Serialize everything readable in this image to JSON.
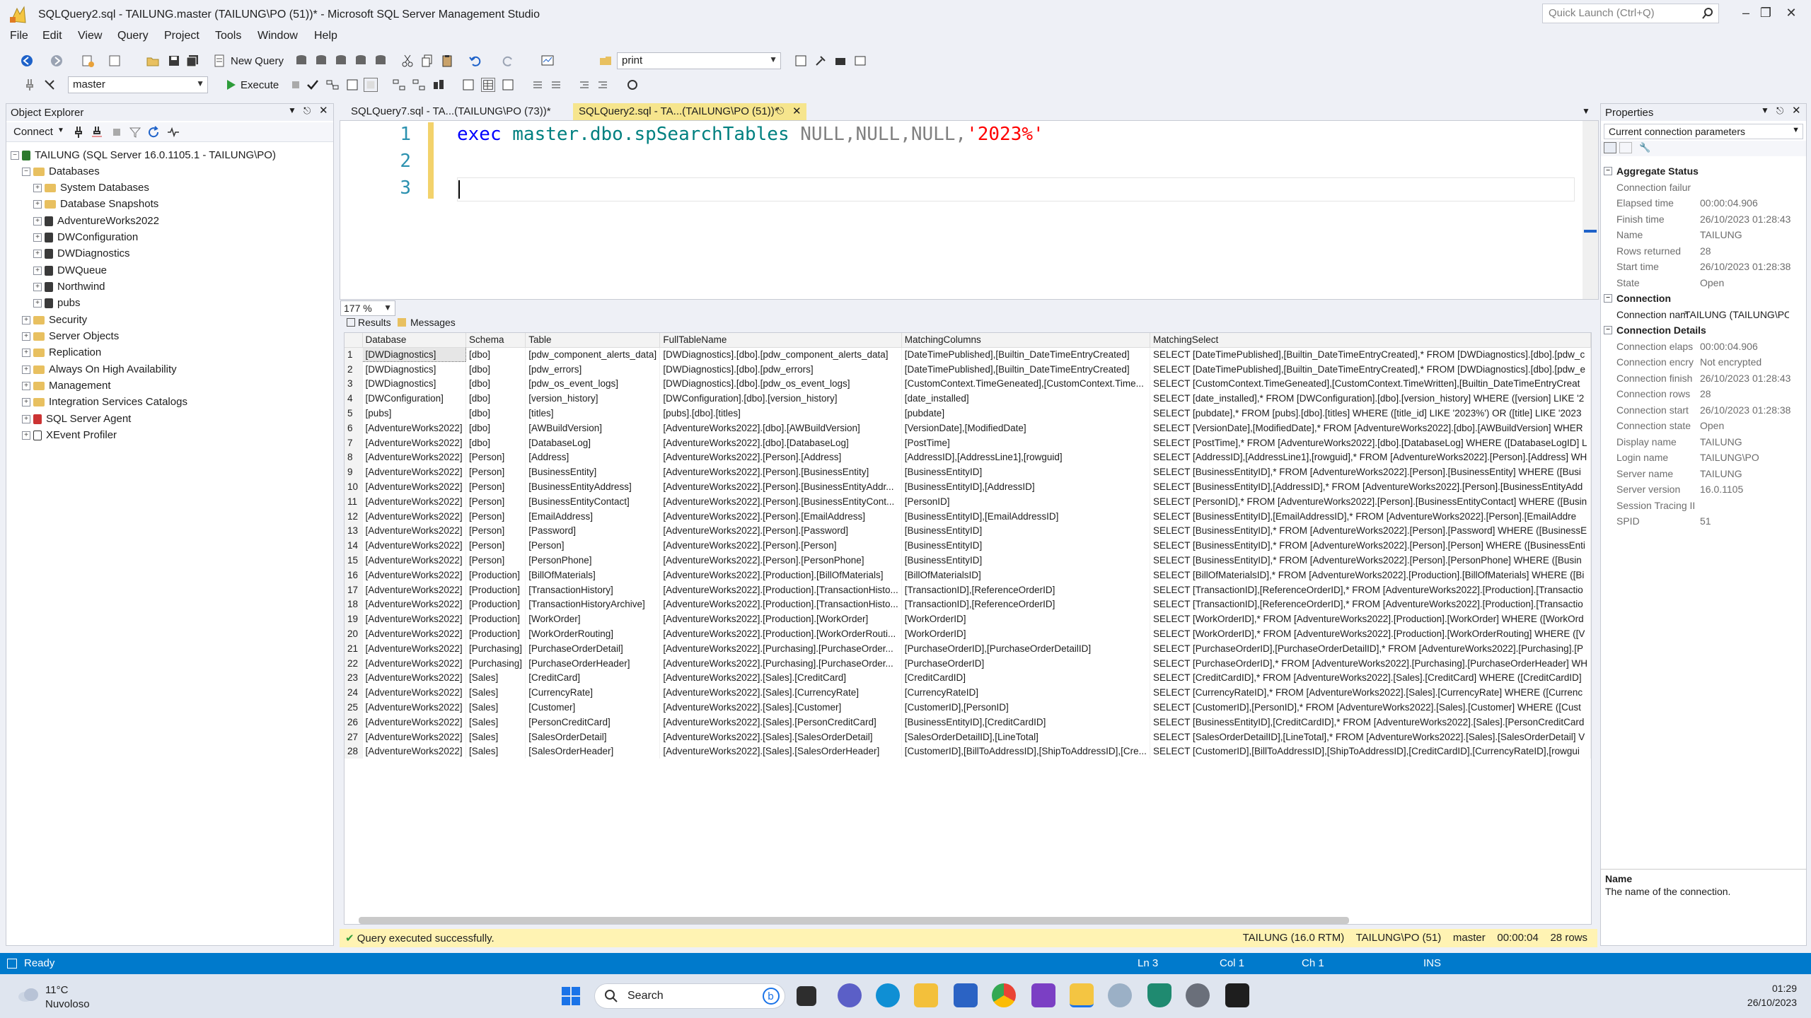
{
  "window": {
    "title": "SQLQuery2.sql - TAILUNG.master (TAILUNG\\PO (51))* - Microsoft SQL Server Management Studio",
    "quick_launch_placeholder": "Quick Launch (Ctrl+Q)"
  },
  "menu": [
    "File",
    "Edit",
    "View",
    "Query",
    "Project",
    "Tools",
    "Window",
    "Help"
  ],
  "toolbar": {
    "new_query": "New Query",
    "solution_combo": "print",
    "database_combo": "master",
    "execute": "Execute"
  },
  "object_explorer": {
    "title": "Object Explorer",
    "connect": "Connect",
    "server": "TAILUNG (SQL Server 16.0.1105.1 - TAILUNG\\PO)",
    "databases_label": "Databases",
    "db_folders": [
      "System Databases",
      "Database Snapshots"
    ],
    "databases": [
      "AdventureWorks2022",
      "DWConfiguration",
      "DWDiagnostics",
      "DWQueue",
      "Northwind",
      "pubs"
    ],
    "server_nodes": [
      "Security",
      "Server Objects",
      "Replication",
      "Always On High Availability",
      "Management",
      "Integration Services Catalogs",
      "SQL Server Agent",
      "XEvent Profiler"
    ]
  },
  "tabs": [
    {
      "label": "SQLQuery7.sql - TA...(TAILUNG\\PO (73))*"
    },
    {
      "label": "SQLQuery2.sql - TA...(TAILUNG\\PO (51))*"
    }
  ],
  "editor": {
    "line_numbers": [
      "1",
      "2",
      "3"
    ],
    "code": {
      "kw": "exec",
      "obj": "master.dbo.spSearchTables",
      "nulls": "NULL,NULL,NULL,",
      "str": "'2023%'"
    },
    "zoom": "177 %"
  },
  "results": {
    "tabs": [
      "Results",
      "Messages"
    ],
    "columns": [
      "Database",
      "Schema",
      "Table",
      "FullTableName",
      "MatchingColumns",
      "MatchingSelect"
    ],
    "rows": [
      [
        "1",
        "[DWDiagnostics]",
        "[dbo]",
        "[pdw_component_alerts_data]",
        "[DWDiagnostics].[dbo].[pdw_component_alerts_data]",
        "[DateTimePublished],[Builtin_DateTimeEntryCreated]",
        "SELECT [DateTimePublished],[Builtin_DateTimeEntryCreated],* FROM [DWDiagnostics].[dbo].[pdw_c"
      ],
      [
        "2",
        "[DWDiagnostics]",
        "[dbo]",
        "[pdw_errors]",
        "[DWDiagnostics].[dbo].[pdw_errors]",
        "[DateTimePublished],[Builtin_DateTimeEntryCreated]",
        "SELECT [DateTimePublished],[Builtin_DateTimeEntryCreated],* FROM [DWDiagnostics].[dbo].[pdw_e"
      ],
      [
        "3",
        "[DWDiagnostics]",
        "[dbo]",
        "[pdw_os_event_logs]",
        "[DWDiagnostics].[dbo].[pdw_os_event_logs]",
        "[CustomContext.TimeGeneated],[CustomContext.Time...",
        "SELECT [CustomContext.TimeGeneated],[CustomContext.TimeWritten],[Builtin_DateTimeEntryCreat"
      ],
      [
        "4",
        "[DWConfiguration]",
        "[dbo]",
        "[version_history]",
        "[DWConfiguration].[dbo].[version_history]",
        "[date_installed]",
        "SELECT [date_installed],* FROM [DWConfiguration].[dbo].[version_history] WHERE ([version] LIKE '2"
      ],
      [
        "5",
        "[pubs]",
        "[dbo]",
        "[titles]",
        "[pubs].[dbo].[titles]",
        "[pubdate]",
        "SELECT [pubdate],* FROM [pubs].[dbo].[titles] WHERE ([title_id] LIKE '2023%') OR ([title] LIKE '2023"
      ],
      [
        "6",
        "[AdventureWorks2022]",
        "[dbo]",
        "[AWBuildVersion]",
        "[AdventureWorks2022].[dbo].[AWBuildVersion]",
        "[VersionDate],[ModifiedDate]",
        "SELECT [VersionDate],[ModifiedDate],* FROM [AdventureWorks2022].[dbo].[AWBuildVersion] WHER"
      ],
      [
        "7",
        "[AdventureWorks2022]",
        "[dbo]",
        "[DatabaseLog]",
        "[AdventureWorks2022].[dbo].[DatabaseLog]",
        "[PostTime]",
        "SELECT [PostTime],* FROM [AdventureWorks2022].[dbo].[DatabaseLog] WHERE ([DatabaseLogID] L"
      ],
      [
        "8",
        "[AdventureWorks2022]",
        "[Person]",
        "[Address]",
        "[AdventureWorks2022].[Person].[Address]",
        "[AddressID],[AddressLine1],[rowguid]",
        "SELECT [AddressID],[AddressLine1],[rowguid],* FROM [AdventureWorks2022].[Person].[Address] WH"
      ],
      [
        "9",
        "[AdventureWorks2022]",
        "[Person]",
        "[BusinessEntity]",
        "[AdventureWorks2022].[Person].[BusinessEntity]",
        "[BusinessEntityID]",
        "SELECT [BusinessEntityID],* FROM [AdventureWorks2022].[Person].[BusinessEntity] WHERE ([Busi"
      ],
      [
        "10",
        "[AdventureWorks2022]",
        "[Person]",
        "[BusinessEntityAddress]",
        "[AdventureWorks2022].[Person].[BusinessEntityAddr...",
        "[BusinessEntityID],[AddressID]",
        "SELECT [BusinessEntityID],[AddressID],* FROM [AdventureWorks2022].[Person].[BusinessEntityAdd"
      ],
      [
        "11",
        "[AdventureWorks2022]",
        "[Person]",
        "[BusinessEntityContact]",
        "[AdventureWorks2022].[Person].[BusinessEntityCont...",
        "[PersonID]",
        "SELECT [PersonID],* FROM [AdventureWorks2022].[Person].[BusinessEntityContact] WHERE ([Busin"
      ],
      [
        "12",
        "[AdventureWorks2022]",
        "[Person]",
        "[EmailAddress]",
        "[AdventureWorks2022].[Person].[EmailAddress]",
        "[BusinessEntityID],[EmailAddressID]",
        "SELECT [BusinessEntityID],[EmailAddressID],* FROM [AdventureWorks2022].[Person].[EmailAddre"
      ],
      [
        "13",
        "[AdventureWorks2022]",
        "[Person]",
        "[Password]",
        "[AdventureWorks2022].[Person].[Password]",
        "[BusinessEntityID]",
        "SELECT [BusinessEntityID],* FROM [AdventureWorks2022].[Person].[Password] WHERE ([BusinessE"
      ],
      [
        "14",
        "[AdventureWorks2022]",
        "[Person]",
        "[Person]",
        "[AdventureWorks2022].[Person].[Person]",
        "[BusinessEntityID]",
        "SELECT [BusinessEntityID],* FROM [AdventureWorks2022].[Person].[Person] WHERE ([BusinessEnti"
      ],
      [
        "15",
        "[AdventureWorks2022]",
        "[Person]",
        "[PersonPhone]",
        "[AdventureWorks2022].[Person].[PersonPhone]",
        "[BusinessEntityID]",
        "SELECT [BusinessEntityID],* FROM [AdventureWorks2022].[Person].[PersonPhone] WHERE ([Busin"
      ],
      [
        "16",
        "[AdventureWorks2022]",
        "[Production]",
        "[BillOfMaterials]",
        "[AdventureWorks2022].[Production].[BillOfMaterials]",
        "[BillOfMaterialsID]",
        "SELECT [BillOfMaterialsID],* FROM [AdventureWorks2022].[Production].[BillOfMaterials] WHERE ([Bi"
      ],
      [
        "17",
        "[AdventureWorks2022]",
        "[Production]",
        "[TransactionHistory]",
        "[AdventureWorks2022].[Production].[TransactionHisto...",
        "[TransactionID],[ReferenceOrderID]",
        "SELECT [TransactionID],[ReferenceOrderID],* FROM [AdventureWorks2022].[Production].[Transactio"
      ],
      [
        "18",
        "[AdventureWorks2022]",
        "[Production]",
        "[TransactionHistoryArchive]",
        "[AdventureWorks2022].[Production].[TransactionHisto...",
        "[TransactionID],[ReferenceOrderID]",
        "SELECT [TransactionID],[ReferenceOrderID],* FROM [AdventureWorks2022].[Production].[Transactio"
      ],
      [
        "19",
        "[AdventureWorks2022]",
        "[Production]",
        "[WorkOrder]",
        "[AdventureWorks2022].[Production].[WorkOrder]",
        "[WorkOrderID]",
        "SELECT [WorkOrderID],* FROM [AdventureWorks2022].[Production].[WorkOrder] WHERE ([WorkOrd"
      ],
      [
        "20",
        "[AdventureWorks2022]",
        "[Production]",
        "[WorkOrderRouting]",
        "[AdventureWorks2022].[Production].[WorkOrderRouti...",
        "[WorkOrderID]",
        "SELECT [WorkOrderID],* FROM [AdventureWorks2022].[Production].[WorkOrderRouting] WHERE ([V"
      ],
      [
        "21",
        "[AdventureWorks2022]",
        "[Purchasing]",
        "[PurchaseOrderDetail]",
        "[AdventureWorks2022].[Purchasing].[PurchaseOrder...",
        "[PurchaseOrderID],[PurchaseOrderDetailID]",
        "SELECT [PurchaseOrderID],[PurchaseOrderDetailID],* FROM [AdventureWorks2022].[Purchasing].[P"
      ],
      [
        "22",
        "[AdventureWorks2022]",
        "[Purchasing]",
        "[PurchaseOrderHeader]",
        "[AdventureWorks2022].[Purchasing].[PurchaseOrder...",
        "[PurchaseOrderID]",
        "SELECT [PurchaseOrderID],* FROM [AdventureWorks2022].[Purchasing].[PurchaseOrderHeader] WH"
      ],
      [
        "23",
        "[AdventureWorks2022]",
        "[Sales]",
        "[CreditCard]",
        "[AdventureWorks2022].[Sales].[CreditCard]",
        "[CreditCardID]",
        "SELECT [CreditCardID],* FROM [AdventureWorks2022].[Sales].[CreditCard] WHERE ([CreditCardID]"
      ],
      [
        "24",
        "[AdventureWorks2022]",
        "[Sales]",
        "[CurrencyRate]",
        "[AdventureWorks2022].[Sales].[CurrencyRate]",
        "[CurrencyRateID]",
        "SELECT [CurrencyRateID],* FROM [AdventureWorks2022].[Sales].[CurrencyRate] WHERE ([Currenc"
      ],
      [
        "25",
        "[AdventureWorks2022]",
        "[Sales]",
        "[Customer]",
        "[AdventureWorks2022].[Sales].[Customer]",
        "[CustomerID],[PersonID]",
        "SELECT [CustomerID],[PersonID],* FROM [AdventureWorks2022].[Sales].[Customer] WHERE ([Cust"
      ],
      [
        "26",
        "[AdventureWorks2022]",
        "[Sales]",
        "[PersonCreditCard]",
        "[AdventureWorks2022].[Sales].[PersonCreditCard]",
        "[BusinessEntityID],[CreditCardID]",
        "SELECT [BusinessEntityID],[CreditCardID],* FROM [AdventureWorks2022].[Sales].[PersonCreditCard"
      ],
      [
        "27",
        "[AdventureWorks2022]",
        "[Sales]",
        "[SalesOrderDetail]",
        "[AdventureWorks2022].[Sales].[SalesOrderDetail]",
        "[SalesOrderDetailID],[LineTotal]",
        "SELECT [SalesOrderDetailID],[LineTotal],* FROM [AdventureWorks2022].[Sales].[SalesOrderDetail] V"
      ],
      [
        "28",
        "[AdventureWorks2022]",
        "[Sales]",
        "[SalesOrderHeader]",
        "[AdventureWorks2022].[Sales].[SalesOrderHeader]",
        "[CustomerID],[BillToAddressID],[ShipToAddressID],[Cre...",
        "SELECT [CustomerID],[BillToAddressID],[ShipToAddressID],[CreditCardID],[CurrencyRateID],[rowgui"
      ]
    ]
  },
  "query_status": {
    "message": "Query executed successfully.",
    "server": "TAILUNG (16.0 RTM)",
    "user": "TAILUNG\\PO (51)",
    "database": "master",
    "elapsed": "00:00:04",
    "rows": "28 rows"
  },
  "properties": {
    "title": "Properties",
    "combo": "Current connection parameters",
    "sections": [
      {
        "name": "Aggregate Status",
        "items": [
          [
            "Connection failur",
            ""
          ],
          [
            "Elapsed time",
            "00:00:04.906"
          ],
          [
            "Finish time",
            "26/10/2023 01:28:43"
          ],
          [
            "Name",
            "TAILUNG"
          ],
          [
            "Rows returned",
            "28"
          ],
          [
            "Start time",
            "26/10/2023 01:28:38"
          ],
          [
            "State",
            "Open"
          ]
        ]
      },
      {
        "name": "Connection",
        "items": [
          [
            "Connection name",
            "TAILUNG (TAILUNG\\PO"
          ]
        ]
      },
      {
        "name": "Connection Details",
        "items": [
          [
            "Connection elaps",
            "00:00:04.906"
          ],
          [
            "Connection encry",
            "Not encrypted"
          ],
          [
            "Connection finish",
            "26/10/2023 01:28:43"
          ],
          [
            "Connection rows",
            "28"
          ],
          [
            "Connection start",
            "26/10/2023 01:28:38"
          ],
          [
            "Connection state",
            "Open"
          ],
          [
            "Display name",
            "TAILUNG"
          ],
          [
            "Login name",
            "TAILUNG\\PO"
          ],
          [
            "Server name",
            "TAILUNG"
          ],
          [
            "Server version",
            "16.0.1105"
          ],
          [
            "Session Tracing II",
            ""
          ],
          [
            "SPID",
            "51"
          ]
        ]
      }
    ],
    "desc_title": "Name",
    "desc_text": "The name of the connection."
  },
  "app_status": {
    "ready": "Ready",
    "ln": "Ln 3",
    "col": "Col 1",
    "ch": "Ch 1",
    "ins": "INS"
  },
  "taskbar": {
    "temp": "11°C",
    "weather": "Nuvoloso",
    "search": "Search",
    "time": "01:29",
    "date": "26/10/2023"
  },
  "colors": {
    "accent": "#007acc",
    "tab_active": "#f6e58d",
    "status_ok": "#fff3b3"
  }
}
